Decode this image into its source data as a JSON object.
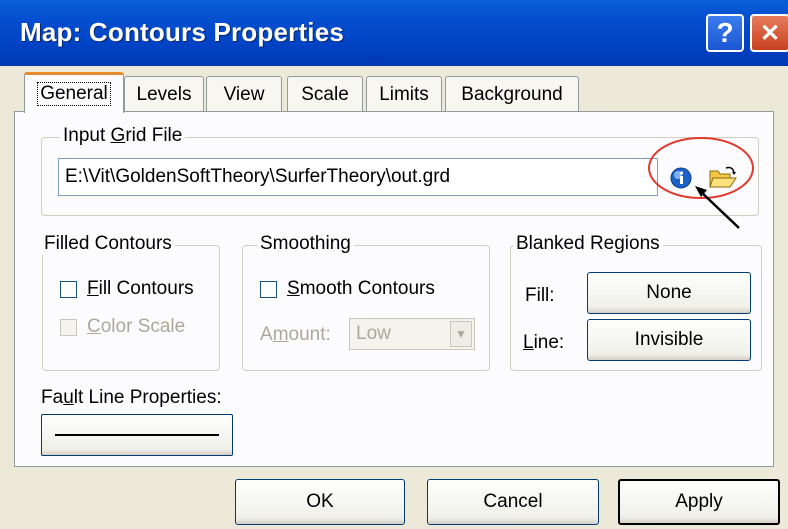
{
  "window": {
    "title": "Map: Contours Properties",
    "help_glyph": "?",
    "close_glyph": "✕"
  },
  "tabs": [
    {
      "label": "General",
      "active": true
    },
    {
      "label": "Levels"
    },
    {
      "label": "View"
    },
    {
      "label": "Scale"
    },
    {
      "label": "Limits"
    },
    {
      "label": "Background"
    }
  ],
  "input_grid": {
    "legend_pre": "Input ",
    "legend_u": "G",
    "legend_post": "rid File",
    "path_value": "E:\\Vit\\GoldenSoftTheory\\SurferTheory\\out.grd",
    "info_icon": "globe-info-icon",
    "open_icon": "open-folder-icon",
    "annotation_color": "#e03a2f"
  },
  "filled_contours": {
    "legend": "Filled Contours",
    "fill_u": "F",
    "fill_rest": "ill Contours",
    "color_u": "C",
    "color_rest": "olor Scale"
  },
  "smoothing": {
    "legend": "Smoothing",
    "smooth_u": "S",
    "smooth_rest": "mooth Contours",
    "amount_pre": "A",
    "amount_u": "m",
    "amount_post": "ount:",
    "amount_value": "Low"
  },
  "blanked": {
    "legend": "Blanked Regions",
    "fill_label": "Fill:",
    "fill_value": "None",
    "line_u": "L",
    "line_rest": "ine:",
    "line_value": "Invisible"
  },
  "fault": {
    "label_pre": "Fa",
    "label_u": "u",
    "label_post": "lt Line Properties:"
  },
  "buttons": {
    "ok": "OK",
    "cancel": "Cancel",
    "apply": "Apply"
  }
}
